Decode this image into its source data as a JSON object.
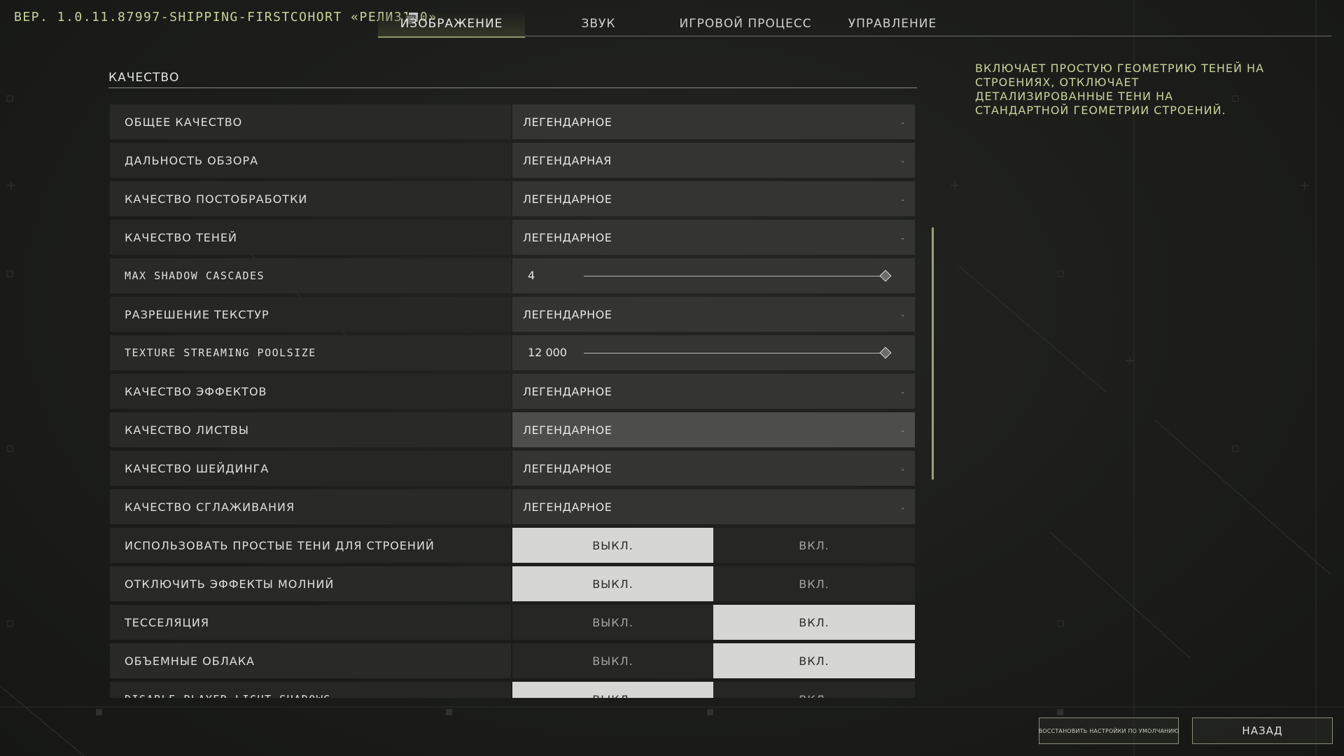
{
  "version_text": "ВЕР. 1.0.11.87997-SHIPPING-FIRSTCOHORT «РЕЛИЗ1.0»",
  "tabs": [
    {
      "label": "ИЗОБРАЖЕНИЕ",
      "active": true
    },
    {
      "label": "ЗВУК",
      "active": false
    },
    {
      "label": "ИГРОВОЙ ПРОЦЕСС",
      "active": false
    },
    {
      "label": "УПРАВЛЕНИЕ",
      "active": false
    }
  ],
  "section": {
    "title": "КАЧЕСТВО"
  },
  "settings": [
    {
      "label": "ОБЩЕЕ КАЧЕСТВО",
      "value": "ЛЕГЕНДАРНОЕ"
    },
    {
      "label": "ДАЛЬНОСТЬ ОБЗОРА",
      "value": "ЛЕГЕНДАРНАЯ"
    },
    {
      "label": "КАЧЕСТВО ПОСТОБРАБОТКИ",
      "value": "ЛЕГЕНДАРНОЕ"
    },
    {
      "label": "КАЧЕСТВО ТЕНЕЙ",
      "value": "ЛЕГЕНДАРНОЕ"
    },
    {
      "label": "MAX SHADOW CASCADES",
      "value": "4"
    },
    {
      "label": "РАЗРЕШЕНИЕ ТЕКСТУР",
      "value": "ЛЕГЕНДАРНОЕ"
    },
    {
      "label": "TEXTURE STREAMING POOLSIZE",
      "value": "12 000"
    },
    {
      "label": "КАЧЕСТВО ЭФФЕКТОВ",
      "value": "ЛЕГЕНДАРНОЕ"
    },
    {
      "label": "КАЧЕСТВО ЛИСТВЫ",
      "value": "ЛЕГЕНДАРНОЕ"
    },
    {
      "label": "КАЧЕСТВО ШЕЙДИНГА",
      "value": "ЛЕГЕНДАРНОЕ"
    },
    {
      "label": "КАЧЕСТВО СГЛАЖИВАНИЯ",
      "value": "ЛЕГЕНДАРНОЕ"
    },
    {
      "label": "ИСПОЛЬЗОВАТЬ ПРОСТЫЕ ТЕНИ ДЛЯ СТРОЕНИЙ",
      "value": "ВЫКЛ."
    },
    {
      "label": "ОТКЛЮЧИТЬ ЭФФЕКТЫ МОЛНИЙ",
      "value": "ВЫКЛ."
    },
    {
      "label": "ТЕССЕЛЯЦИЯ",
      "value": "ВКЛ."
    },
    {
      "label": "ОБЪЕМНЫЕ ОБЛАКА",
      "value": "ВКЛ."
    },
    {
      "label": "DISABLE PLAYER LIGHT SHADOWS",
      "value": "ВЫКЛ."
    }
  ],
  "slider_levels": {
    "max_shadow_cascades": 1.0,
    "texture_streaming_poolsize": 1.0
  },
  "toggle_labels": {
    "off": "ВЫКЛ.",
    "on": "ВКЛ."
  },
  "dropdown_caret": "-",
  "description": "ВКЛЮЧАЕТ ПРОСТУЮ ГЕОМЕТРИЮ ТЕНЕЙ НА СТРОЕНИЯХ, ОТКЛЮЧАЕТ ДЕТАЛИЗИРОВАННЫЕ ТЕНИ НА СТАНДАРТНОЙ ГЕОМЕТРИИ СТРОЕНИЙ.",
  "buttons": {
    "reset": "ВОССТАНОВИТЬ НАСТРОЙКИ ПО УМОЛЧАНИЮ",
    "back": "НАЗАД"
  },
  "colors": {
    "accent_text": "#c9d29a",
    "toggle_selected": "#d6d6d3",
    "scrollbar": "#9aa07a"
  },
  "icons": {
    "version_copy": "copy-icon",
    "dropdown": "dropdown-caret-icon",
    "slider_knob": "diamond-knob-icon"
  }
}
